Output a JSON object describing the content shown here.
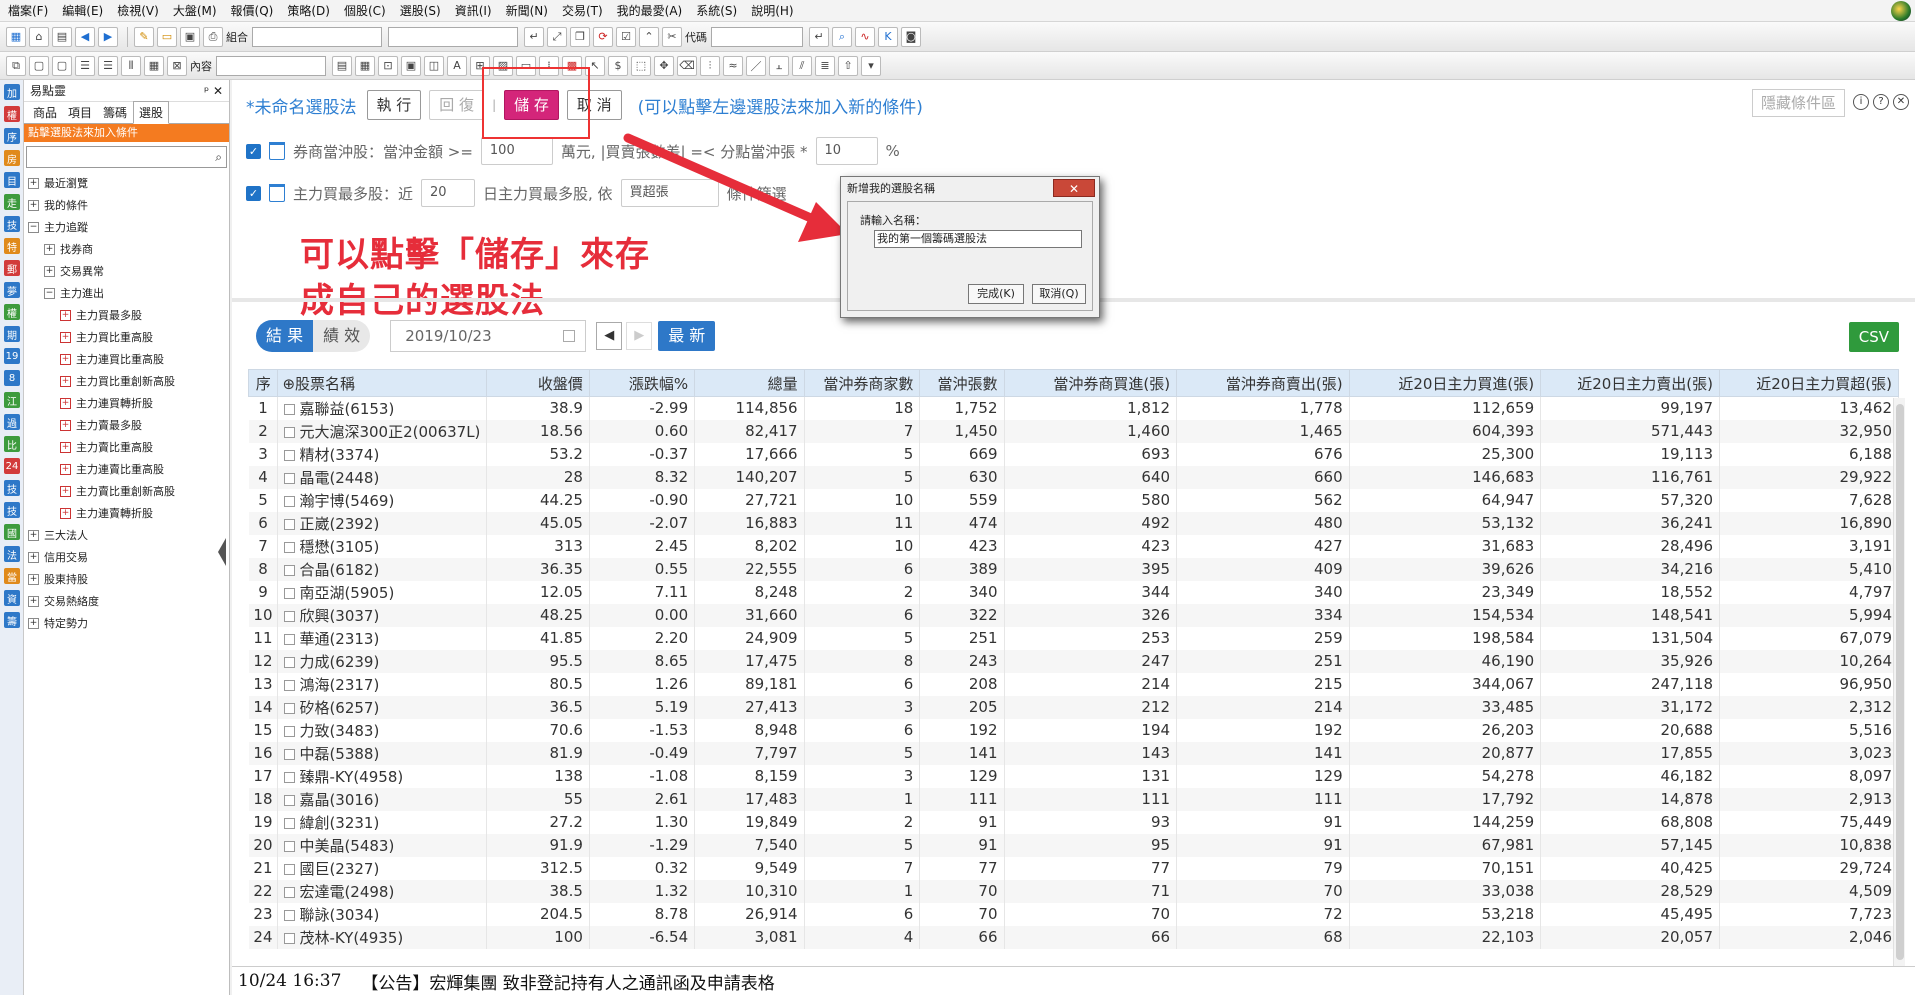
{
  "menu": [
    "檔案(F)",
    "編輯(E)",
    "檢視(V)",
    "大盤(M)",
    "報價(Q)",
    "策略(D)",
    "個股(C)",
    "選股(S)",
    "資訊(I)",
    "新聞(N)",
    "交易(T)",
    "我的最愛(A)",
    "系統(S)",
    "說明(H)"
  ],
  "toolbar": {
    "combo_label": "組合",
    "code_label": "代碼",
    "content_label": "內容"
  },
  "lefticons": [
    "加",
    "權",
    "序",
    "房",
    "目",
    "走",
    "技",
    "特",
    "郵",
    "夢",
    "權",
    "期",
    "19",
    "8",
    "江",
    "過",
    "比",
    "24",
    "技",
    "技",
    "國",
    "法",
    "當",
    "資",
    "籌"
  ],
  "tree": {
    "title": "易點靈",
    "pin": "ᵖ ✕",
    "tabs": [
      "商品",
      "項目",
      "籌碼",
      "選股"
    ],
    "orange_tip": "點擊選股法來加入條件",
    "nodes": [
      {
        "t": "最近瀏覽",
        "lvl": 0,
        "pm": "+"
      },
      {
        "t": "我的條件",
        "lvl": 0,
        "pm": "+"
      },
      {
        "t": "主力追蹤",
        "lvl": 0,
        "pm": "−"
      },
      {
        "t": "找券商",
        "lvl": 1,
        "pm": "+"
      },
      {
        "t": "交易異常",
        "lvl": 1,
        "pm": "+"
      },
      {
        "t": "主力進出",
        "lvl": 1,
        "pm": "−"
      },
      {
        "t": "主力買最多股",
        "lvl": 2,
        "leaf": true
      },
      {
        "t": "主力買比重高股",
        "lvl": 2,
        "leaf": true
      },
      {
        "t": "主力連買比重高股",
        "lvl": 2,
        "leaf": true
      },
      {
        "t": "主力買比重創新高股",
        "lvl": 2,
        "leaf": true
      },
      {
        "t": "主力連買轉折股",
        "lvl": 2,
        "leaf": true
      },
      {
        "t": "主力賣最多股",
        "lvl": 2,
        "leaf": true
      },
      {
        "t": "主力賣比重高股",
        "lvl": 2,
        "leaf": true
      },
      {
        "t": "主力連賣比重高股",
        "lvl": 2,
        "leaf": true
      },
      {
        "t": "主力賣比重創新高股",
        "lvl": 2,
        "leaf": true
      },
      {
        "t": "主力連賣轉折股",
        "lvl": 2,
        "leaf": true
      },
      {
        "t": "三大法人",
        "lvl": 0,
        "pm": "+"
      },
      {
        "t": "信用交易",
        "lvl": 0,
        "pm": "+"
      },
      {
        "t": "股東持股",
        "lvl": 0,
        "pm": "+"
      },
      {
        "t": "交易熱絡度",
        "lvl": 0,
        "pm": "+"
      },
      {
        "t": "特定勢力",
        "lvl": 0,
        "pm": "+"
      }
    ]
  },
  "cond": {
    "title": "*未命名選股法",
    "run": "執 行",
    "restore": "回 復",
    "save": "儲 存",
    "cancel": "取 消",
    "hint": "(可以點擊左邊選股法來加入新的條件)",
    "hide": "隱藏條件區",
    "c1a": "券商當沖股：當沖金額 >=",
    "c1v": "100",
    "c1b": "萬元, |買賣張數差| =< 分點當沖張 *",
    "c1v2": "10",
    "c1c": "%",
    "c2a": "主力買最多股：近",
    "c2v": "20",
    "c2b": "日主力買最多股, 依",
    "c2v2": "買超張",
    "c2c": "條件篩選"
  },
  "annotation": "可以點擊「儲存」來存成自己的選股法",
  "dialog": {
    "title": "新增我的選股名稱",
    "close": "✕",
    "prompt": "請輸入名稱：",
    "value": "我的第一個籌碼選股法",
    "ok": "完成(K)",
    "cancel": "取消(Q)"
  },
  "results": {
    "tab_result": "結 果",
    "tab_perf": "績 效",
    "date": "2019/10/23",
    "latest": "最 新",
    "csv": "CSV"
  },
  "table": {
    "headers": [
      "序",
      "⊕股票名稱",
      "收盤價",
      "漲跌幅%",
      "總量",
      "當沖券商家數",
      "當沖張數",
      "當沖券商買進(張)",
      "當沖券商賣出(張)",
      "近20日主力買進(張)",
      "近20日主力賣出(張)",
      "近20日主力買超(張)"
    ],
    "rows": [
      [
        "1",
        "嘉聯益(6153)",
        "38.9",
        "-2.99",
        "114,856",
        "18",
        "1,752",
        "1,812",
        "1,778",
        "112,659",
        "99,197",
        "13,462"
      ],
      [
        "2",
        "元大滬深300正2(00637L)",
        "18.56",
        "0.60",
        "82,417",
        "7",
        "1,450",
        "1,460",
        "1,465",
        "604,393",
        "571,443",
        "32,950"
      ],
      [
        "3",
        "精材(3374)",
        "53.2",
        "-0.37",
        "17,666",
        "5",
        "669",
        "693",
        "676",
        "25,300",
        "19,113",
        "6,188"
      ],
      [
        "4",
        "晶電(2448)",
        "28",
        "8.32",
        "140,207",
        "5",
        "630",
        "640",
        "660",
        "146,683",
        "116,761",
        "29,922"
      ],
      [
        "5",
        "瀚宇博(5469)",
        "44.25",
        "-0.90",
        "27,721",
        "10",
        "559",
        "580",
        "562",
        "64,947",
        "57,320",
        "7,628"
      ],
      [
        "6",
        "正崴(2392)",
        "45.05",
        "-2.07",
        "16,883",
        "11",
        "474",
        "492",
        "480",
        "53,132",
        "36,241",
        "16,890"
      ],
      [
        "7",
        "穩懋(3105)",
        "313",
        "2.45",
        "8,202",
        "10",
        "423",
        "423",
        "427",
        "31,683",
        "28,496",
        "3,191"
      ],
      [
        "8",
        "合晶(6182)",
        "36.35",
        "0.55",
        "22,555",
        "6",
        "389",
        "395",
        "409",
        "39,626",
        "34,216",
        "5,410"
      ],
      [
        "9",
        "南亞湖(5905)",
        "12.05",
        "7.11",
        "8,248",
        "2",
        "340",
        "344",
        "340",
        "23,349",
        "18,552",
        "4,797"
      ],
      [
        "10",
        "欣興(3037)",
        "48.25",
        "0.00",
        "31,660",
        "6",
        "322",
        "326",
        "334",
        "154,534",
        "148,541",
        "5,994"
      ],
      [
        "11",
        "華通(2313)",
        "41.85",
        "2.20",
        "24,909",
        "5",
        "251",
        "253",
        "259",
        "198,584",
        "131,504",
        "67,079"
      ],
      [
        "12",
        "力成(6239)",
        "95.5",
        "8.65",
        "17,475",
        "8",
        "243",
        "247",
        "251",
        "46,190",
        "35,926",
        "10,264"
      ],
      [
        "13",
        "鴻海(2317)",
        "80.5",
        "1.26",
        "89,181",
        "6",
        "208",
        "214",
        "215",
        "344,067",
        "247,118",
        "96,950"
      ],
      [
        "14",
        "矽格(6257)",
        "36.5",
        "5.19",
        "27,413",
        "3",
        "205",
        "212",
        "214",
        "33,485",
        "31,172",
        "2,312"
      ],
      [
        "15",
        "力致(3483)",
        "70.6",
        "-1.53",
        "8,948",
        "6",
        "192",
        "194",
        "192",
        "26,203",
        "20,688",
        "5,516"
      ],
      [
        "16",
        "中磊(5388)",
        "81.9",
        "-0.49",
        "7,797",
        "5",
        "141",
        "143",
        "141",
        "20,877",
        "17,855",
        "3,023"
      ],
      [
        "17",
        "臻鼎-KY(4958)",
        "138",
        "-1.08",
        "8,159",
        "3",
        "129",
        "131",
        "129",
        "54,278",
        "46,182",
        "8,097"
      ],
      [
        "18",
        "嘉晶(3016)",
        "55",
        "2.61",
        "17,483",
        "1",
        "111",
        "111",
        "111",
        "17,792",
        "14,878",
        "2,913"
      ],
      [
        "19",
        "緯創(3231)",
        "27.2",
        "1.30",
        "19,849",
        "2",
        "91",
        "93",
        "91",
        "144,259",
        "68,808",
        "75,449"
      ],
      [
        "20",
        "中美晶(5483)",
        "91.9",
        "-1.29",
        "7,540",
        "5",
        "91",
        "95",
        "91",
        "67,981",
        "57,145",
        "10,838"
      ],
      [
        "21",
        "國巨(2327)",
        "312.5",
        "0.32",
        "9,549",
        "7",
        "77",
        "77",
        "79",
        "70,151",
        "40,425",
        "29,724"
      ],
      [
        "22",
        "宏達電(2498)",
        "38.5",
        "1.32",
        "10,310",
        "1",
        "70",
        "71",
        "70",
        "33,038",
        "28,529",
        "4,509"
      ],
      [
        "23",
        "聯詠(3034)",
        "204.5",
        "8.78",
        "26,914",
        "6",
        "70",
        "70",
        "72",
        "53,218",
        "45,495",
        "7,723"
      ],
      [
        "24",
        "茂林-KY(4935)",
        "100",
        "-6.54",
        "3,081",
        "4",
        "66",
        "66",
        "68",
        "22,103",
        "20,057",
        "2,046"
      ]
    ]
  },
  "news": {
    "time": "10/24 16:37",
    "text": "【公告】宏輝集團 致非登記持有人之通訊函及申請表格"
  }
}
